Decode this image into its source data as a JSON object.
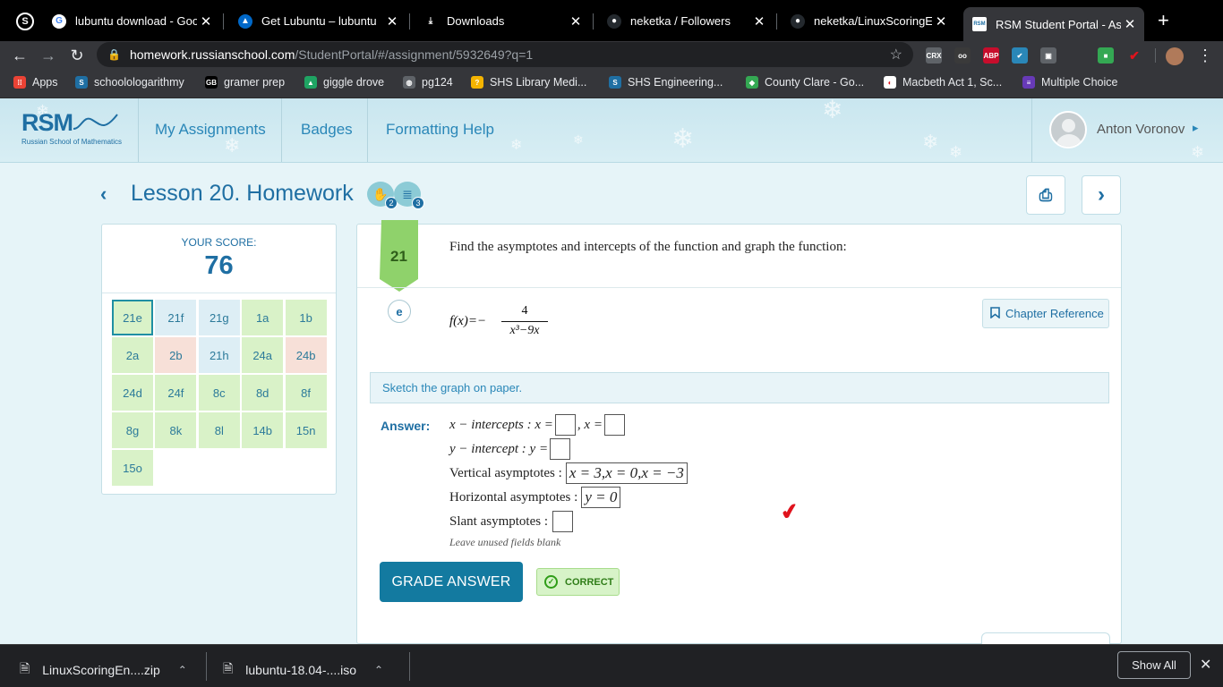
{
  "browser": {
    "tabs": [
      {
        "title": "lubuntu download - Goog",
        "icon": "google-icon",
        "fav_bg": "#ffffff",
        "fav_color": "#4285f4",
        "glyph": "G"
      },
      {
        "title": "Get Lubuntu – lubuntu",
        "icon": "lubuntu-icon",
        "fav_bg": "#0068c8",
        "fav_color": "#ffffff",
        "glyph": "▲"
      },
      {
        "title": "Downloads",
        "icon": "download-icon",
        "fav_bg": "transparent",
        "fav_color": "#ffffff",
        "glyph": "⤓"
      },
      {
        "title": "neketka / Followers",
        "icon": "github-icon",
        "fav_bg": "#24292e",
        "fav_color": "#ffffff",
        "glyph": "●"
      },
      {
        "title": "neketka/LinuxScoringEng",
        "icon": "github-icon",
        "fav_bg": "#24292e",
        "fav_color": "#ffffff",
        "glyph": "●"
      },
      {
        "title": "RSM Student Portal - Ass",
        "icon": "rsm-icon",
        "fav_bg": "#ffffff",
        "fav_color": "#1f6fa3",
        "glyph": "RSM",
        "active": true
      }
    ],
    "close_glyph": "✕",
    "new_tab_glyph": "+",
    "url_host": "homework.russianschool.com",
    "url_path": "/StudentPortal/#/assignment/5932649?q=1",
    "back_glyph": "←",
    "forward_glyph": "→",
    "reload_glyph": "↻",
    "star_glyph": "☆",
    "lock_glyph": "🔒",
    "menu_glyph": "⋮",
    "extensions": [
      {
        "name": "crx-icon",
        "label": "CRX",
        "bg": "#5f6368"
      },
      {
        "name": "owl-icon",
        "label": "oo",
        "bg": "#3a3a3a"
      },
      {
        "name": "adblock-icon",
        "label": "ABP",
        "bg": "#c70d2c"
      },
      {
        "name": "tick-extension-icon",
        "label": "✔",
        "bg": "#2a87b8"
      },
      {
        "name": "briefcase-icon",
        "label": "▣",
        "bg": "#5f6368"
      },
      {
        "name": "color-picker-icon",
        "label": "■",
        "bg": "#34a853"
      },
      {
        "name": "checkmark-red-icon",
        "label": "✔",
        "bg": "transparent"
      }
    ],
    "bookmarks": [
      {
        "label": "Apps",
        "icon": "apps-grid-icon",
        "bg": "#ea4335",
        "glyph": "⁞⁞"
      },
      {
        "label": "schoolologarithmy",
        "icon": "schoology-icon",
        "bg": "#1f6fa3",
        "glyph": "S"
      },
      {
        "label": "gramer prep",
        "icon": "gb-icon",
        "bg": "#000000",
        "glyph": "GB"
      },
      {
        "label": "giggle drove",
        "icon": "google-drive-icon",
        "bg": "#1fa463",
        "glyph": "▲"
      },
      {
        "label": "pg124",
        "icon": "globe-icon",
        "bg": "#5f6368",
        "glyph": "◍"
      },
      {
        "label": "SHS Library Medi...",
        "icon": "library-icon",
        "bg": "#f4b400",
        "glyph": "?"
      },
      {
        "label": "SHS Engineering...",
        "icon": "schoology-icon",
        "bg": "#1f6fa3",
        "glyph": "S"
      },
      {
        "label": "County Clare - Go...",
        "icon": "maps-icon",
        "bg": "#34a853",
        "glyph": "◆"
      },
      {
        "label": "Macbeth Act 1, Sc...",
        "icon": "sparknotes-icon",
        "bg": "#ffffff",
        "glyph": "◐"
      },
      {
        "label": "Multiple Choice",
        "icon": "forms-icon",
        "bg": "#673ab7",
        "glyph": "≡"
      }
    ]
  },
  "header": {
    "logo_text": "RSM",
    "logo_subtitle": "Russian School of Mathematics",
    "nav": [
      "My Assignments",
      "Badges",
      "Formatting Help"
    ],
    "user_name": "Anton Voronov",
    "user_caret": "▸"
  },
  "lesson": {
    "back_glyph": "‹",
    "title": "Lesson 20. Homework",
    "badges": [
      {
        "name": "hands-badge-icon",
        "glyph": "✋",
        "count": "2"
      },
      {
        "name": "books-badge-icon",
        "glyph": "≣",
        "count": "3"
      }
    ],
    "print_glyph": "⎙",
    "next_glyph": "›"
  },
  "score": {
    "label": "YOUR SCORE:",
    "value": "76",
    "problems": [
      {
        "label": "21e",
        "status": "g",
        "selected": true
      },
      {
        "label": "21f",
        "status": "b"
      },
      {
        "label": "21g",
        "status": "b"
      },
      {
        "label": "1a",
        "status": "g"
      },
      {
        "label": "1b",
        "status": "g"
      },
      {
        "label": "2a",
        "status": "g"
      },
      {
        "label": "2b",
        "status": "r"
      },
      {
        "label": "21h",
        "status": "b"
      },
      {
        "label": "24a",
        "status": "g"
      },
      {
        "label": "24b",
        "status": "r"
      },
      {
        "label": "24d",
        "status": "g"
      },
      {
        "label": "24f",
        "status": "g"
      },
      {
        "label": "8c",
        "status": "g"
      },
      {
        "label": "8d",
        "status": "g"
      },
      {
        "label": "8f",
        "status": "g"
      },
      {
        "label": "8g",
        "status": "g"
      },
      {
        "label": "8k",
        "status": "g"
      },
      {
        "label": "8l",
        "status": "g"
      },
      {
        "label": "14b",
        "status": "g"
      },
      {
        "label": "15n",
        "status": "g"
      },
      {
        "label": "15o",
        "status": "g"
      }
    ]
  },
  "question": {
    "number": "21",
    "text": "Find the asymptotes and intercepts of the function and graph the function:",
    "part": "e",
    "formula_lhs": "f(x)=−",
    "formula_num": "4",
    "formula_den": "x³−9x",
    "chapter_ref": "Chapter Reference",
    "sketch_note": "Sketch the graph on paper.",
    "answer_label": "Answer:",
    "lines": {
      "x_intercepts_a": "x − intercepts : x =",
      "x_intercepts_b": ", x =",
      "y_intercept": "y − intercept : y =",
      "vertical": "Vertical asymptotes :",
      "vertical_value": "x = 3,x = 0,x = −3",
      "horizontal": "Horizontal asymptotes :",
      "horizontal_value": "y = 0",
      "slant": "Slant asymptotes :"
    },
    "hint": "Leave unused fields blank",
    "grade_button": "GRADE ANSWER",
    "status": "CORRECT",
    "status_glyph": "✓",
    "check_glyph": "✔"
  },
  "downloads": {
    "items": [
      {
        "name": "LinuxScoringEn....zip"
      },
      {
        "name": "lubuntu-18.04-....iso"
      }
    ],
    "file_glyph": "🗎",
    "caret_glyph": "⌃",
    "show_all": "Show All",
    "close_glyph": "✕"
  }
}
